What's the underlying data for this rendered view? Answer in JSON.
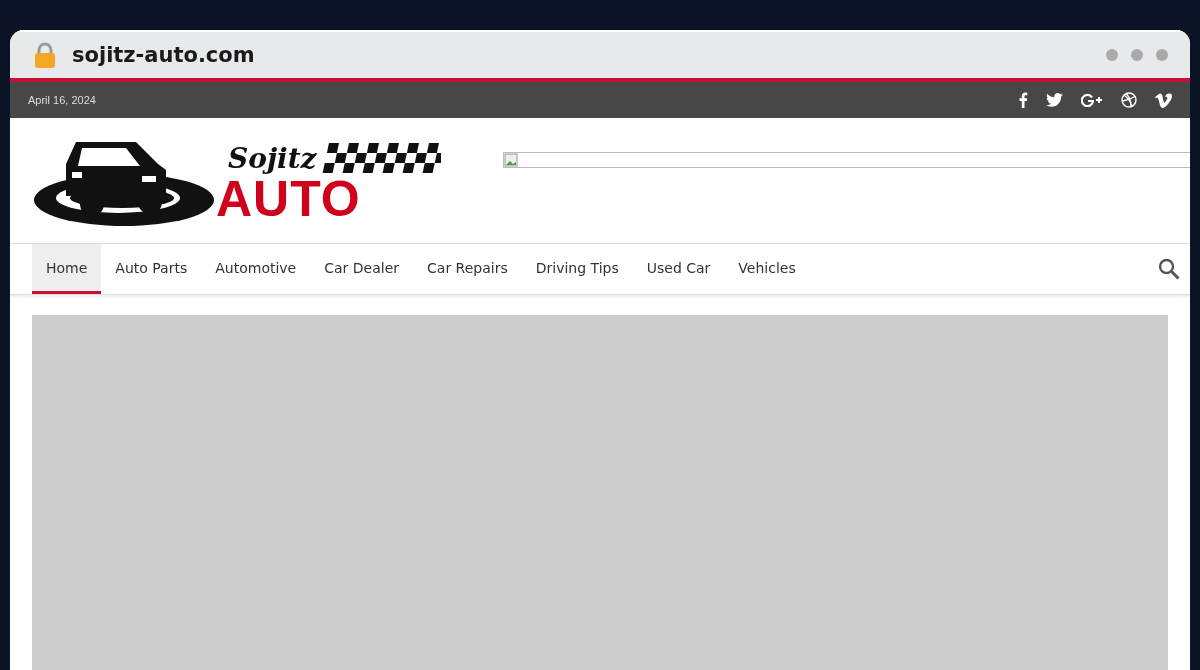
{
  "browser": {
    "url": "sojitz-auto.com"
  },
  "top_bar": {
    "date": "April 16, 2024",
    "social": [
      {
        "kind": "facebook"
      },
      {
        "kind": "twitter"
      },
      {
        "kind": "google-plus"
      },
      {
        "kind": "dribbble"
      },
      {
        "kind": "vimeo"
      }
    ]
  },
  "logo": {
    "line_1": "Sojitz",
    "line_2": "AUTO"
  },
  "nav": {
    "items": [
      {
        "label": "Home",
        "selected": true
      },
      {
        "label": "Auto Parts",
        "selected": false
      },
      {
        "label": "Automotive",
        "selected": false
      },
      {
        "label": "Car Dealer",
        "selected": false
      },
      {
        "label": "Car Repairs",
        "selected": false
      },
      {
        "label": "Driving Tips",
        "selected": false
      },
      {
        "label": "Used Car",
        "selected": false
      },
      {
        "label": "Vehicles",
        "selected": false
      }
    ]
  }
}
